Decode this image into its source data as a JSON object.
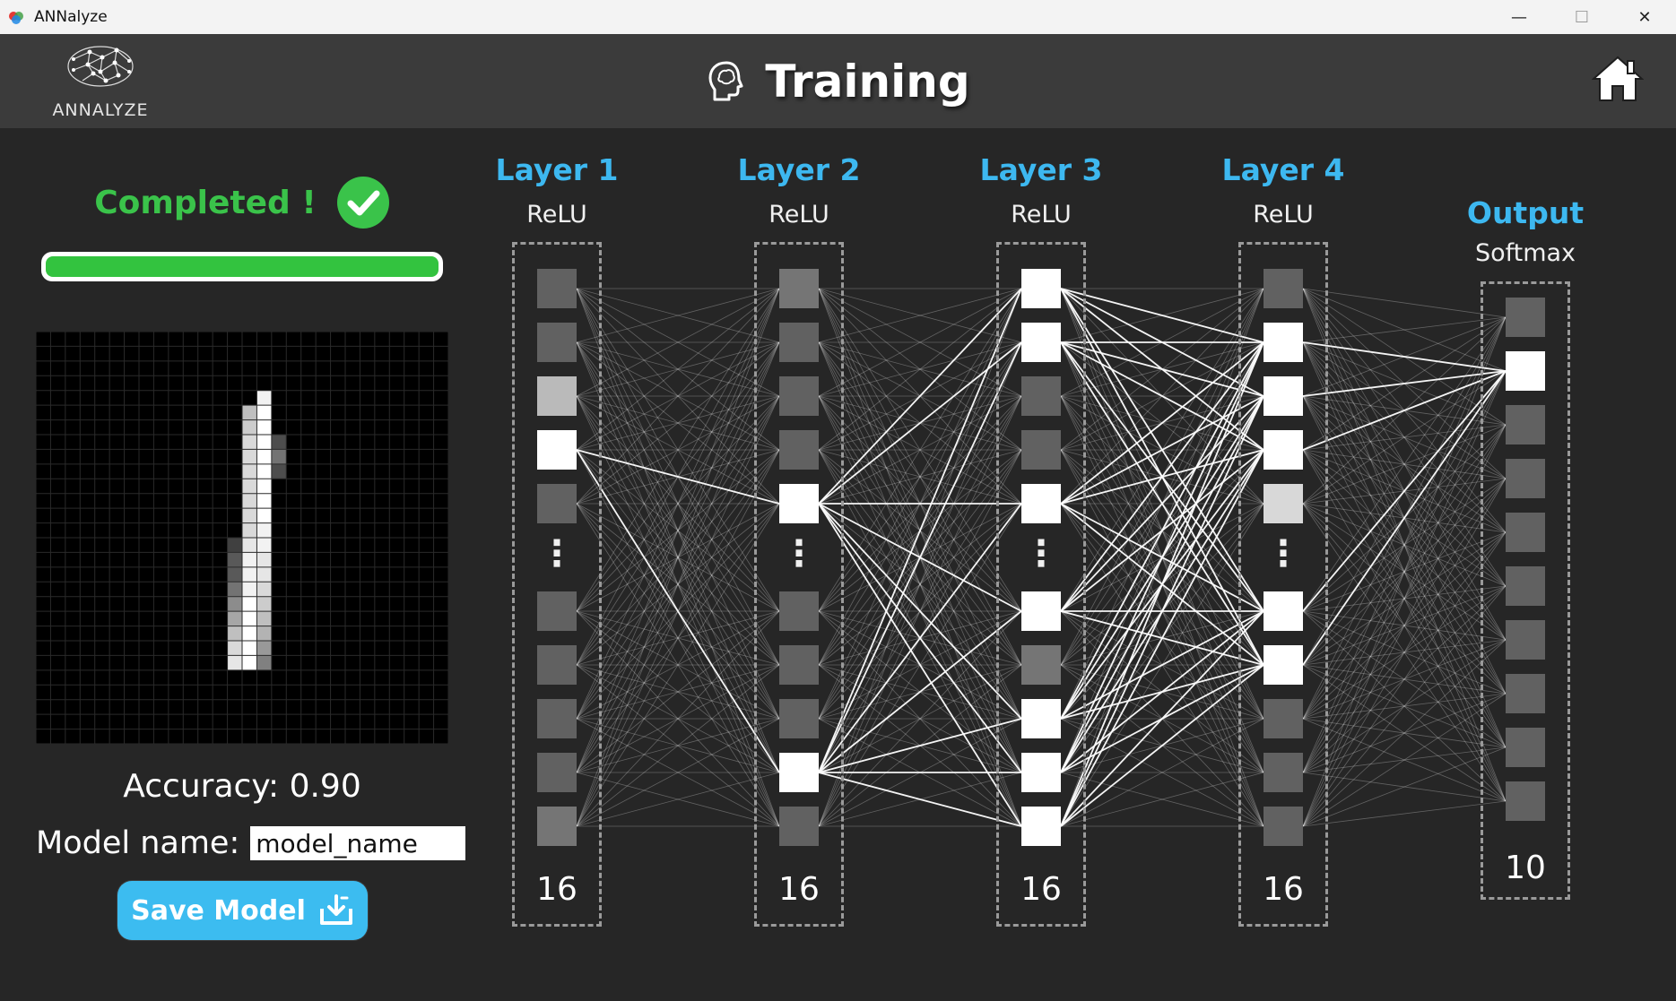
{
  "window": {
    "title": "ANNalyze",
    "minimize_glyph": "—",
    "maximize_glyph": "☐",
    "close_glyph": "✕"
  },
  "header": {
    "logo_text": "ANNALYZE",
    "title": "Training",
    "title_icon": "brain-head-icon",
    "home_icon": "home-icon"
  },
  "status": {
    "text": "Completed !",
    "icon": "check-circle-icon",
    "color": "#3ac34a",
    "progress": 1.0
  },
  "digit_preview": {
    "rows": 28,
    "cols": 28,
    "pixels": [
      {
        "r": 4,
        "c": 15,
        "v": 0.95
      },
      {
        "r": 5,
        "c": 14,
        "v": 0.75
      },
      {
        "r": 5,
        "c": 15,
        "v": 1.0
      },
      {
        "r": 6,
        "c": 14,
        "v": 0.8
      },
      {
        "r": 6,
        "c": 15,
        "v": 1.0
      },
      {
        "r": 7,
        "c": 14,
        "v": 0.85
      },
      {
        "r": 7,
        "c": 15,
        "v": 1.0
      },
      {
        "r": 7,
        "c": 16,
        "v": 0.3
      },
      {
        "r": 8,
        "c": 14,
        "v": 0.85
      },
      {
        "r": 8,
        "c": 15,
        "v": 1.0
      },
      {
        "r": 8,
        "c": 16,
        "v": 0.45
      },
      {
        "r": 9,
        "c": 14,
        "v": 0.85
      },
      {
        "r": 9,
        "c": 15,
        "v": 1.0
      },
      {
        "r": 9,
        "c": 16,
        "v": 0.3
      },
      {
        "r": 10,
        "c": 14,
        "v": 0.85
      },
      {
        "r": 10,
        "c": 15,
        "v": 1.0
      },
      {
        "r": 11,
        "c": 14,
        "v": 0.85
      },
      {
        "r": 11,
        "c": 15,
        "v": 1.0
      },
      {
        "r": 12,
        "c": 14,
        "v": 0.85
      },
      {
        "r": 12,
        "c": 15,
        "v": 1.0
      },
      {
        "r": 13,
        "c": 14,
        "v": 0.85
      },
      {
        "r": 13,
        "c": 15,
        "v": 0.95
      },
      {
        "r": 14,
        "c": 13,
        "v": 0.25
      },
      {
        "r": 14,
        "c": 14,
        "v": 0.9
      },
      {
        "r": 14,
        "c": 15,
        "v": 0.95
      },
      {
        "r": 15,
        "c": 13,
        "v": 0.35
      },
      {
        "r": 15,
        "c": 14,
        "v": 0.95
      },
      {
        "r": 15,
        "c": 15,
        "v": 0.9
      },
      {
        "r": 16,
        "c": 13,
        "v": 0.35
      },
      {
        "r": 16,
        "c": 14,
        "v": 0.95
      },
      {
        "r": 16,
        "c": 15,
        "v": 0.9
      },
      {
        "r": 17,
        "c": 13,
        "v": 0.45
      },
      {
        "r": 17,
        "c": 14,
        "v": 0.95
      },
      {
        "r": 17,
        "c": 15,
        "v": 0.85
      },
      {
        "r": 18,
        "c": 13,
        "v": 0.55
      },
      {
        "r": 18,
        "c": 14,
        "v": 1.0
      },
      {
        "r": 18,
        "c": 15,
        "v": 0.8
      },
      {
        "r": 19,
        "c": 13,
        "v": 0.65
      },
      {
        "r": 19,
        "c": 14,
        "v": 1.0
      },
      {
        "r": 19,
        "c": 15,
        "v": 0.75
      },
      {
        "r": 20,
        "c": 13,
        "v": 0.75
      },
      {
        "r": 20,
        "c": 14,
        "v": 1.0
      },
      {
        "r": 20,
        "c": 15,
        "v": 0.7
      },
      {
        "r": 21,
        "c": 13,
        "v": 0.85
      },
      {
        "r": 21,
        "c": 14,
        "v": 1.0
      },
      {
        "r": 21,
        "c": 15,
        "v": 0.6
      },
      {
        "r": 22,
        "c": 13,
        "v": 0.9
      },
      {
        "r": 22,
        "c": 14,
        "v": 1.0
      },
      {
        "r": 22,
        "c": 15,
        "v": 0.5
      }
    ]
  },
  "accuracy_text": "Accuracy: 0.90",
  "model": {
    "label": "Model name:",
    "value": "model_name"
  },
  "save_button": {
    "label": "Save Model",
    "icon": "download-tray-icon",
    "color": "#3cbcf0"
  },
  "network": {
    "accent": "#3db8f0",
    "ellipsis": "⋮",
    "layers": [
      {
        "title": "Layer 1",
        "activation": "ReLU",
        "count": "16",
        "activations": [
          0.2,
          0.2,
          0.65,
          1.0,
          0.2,
          0.2,
          0.2,
          0.2,
          0.2,
          0.3
        ]
      },
      {
        "title": "Layer 2",
        "activation": "ReLU",
        "count": "16",
        "activations": [
          0.3,
          0.2,
          0.2,
          0.2,
          1.0,
          0.2,
          0.2,
          0.2,
          1.0,
          0.2
        ]
      },
      {
        "title": "Layer 3",
        "activation": "ReLU",
        "count": "16",
        "activations": [
          1.0,
          1.0,
          0.2,
          0.2,
          1.0,
          1.0,
          0.3,
          1.0,
          1.0,
          1.0
        ]
      },
      {
        "title": "Layer 4",
        "activation": "ReLU",
        "count": "16",
        "activations": [
          0.2,
          1.0,
          1.0,
          1.0,
          0.8,
          1.0,
          1.0,
          0.2,
          0.2,
          0.2
        ]
      }
    ],
    "output": {
      "title": "Output",
      "activation": "Softmax",
      "count": "10",
      "activations": [
        0.2,
        1.0,
        0.2,
        0.2,
        0.2,
        0.2,
        0.2,
        0.2,
        0.2,
        0.2
      ]
    }
  }
}
